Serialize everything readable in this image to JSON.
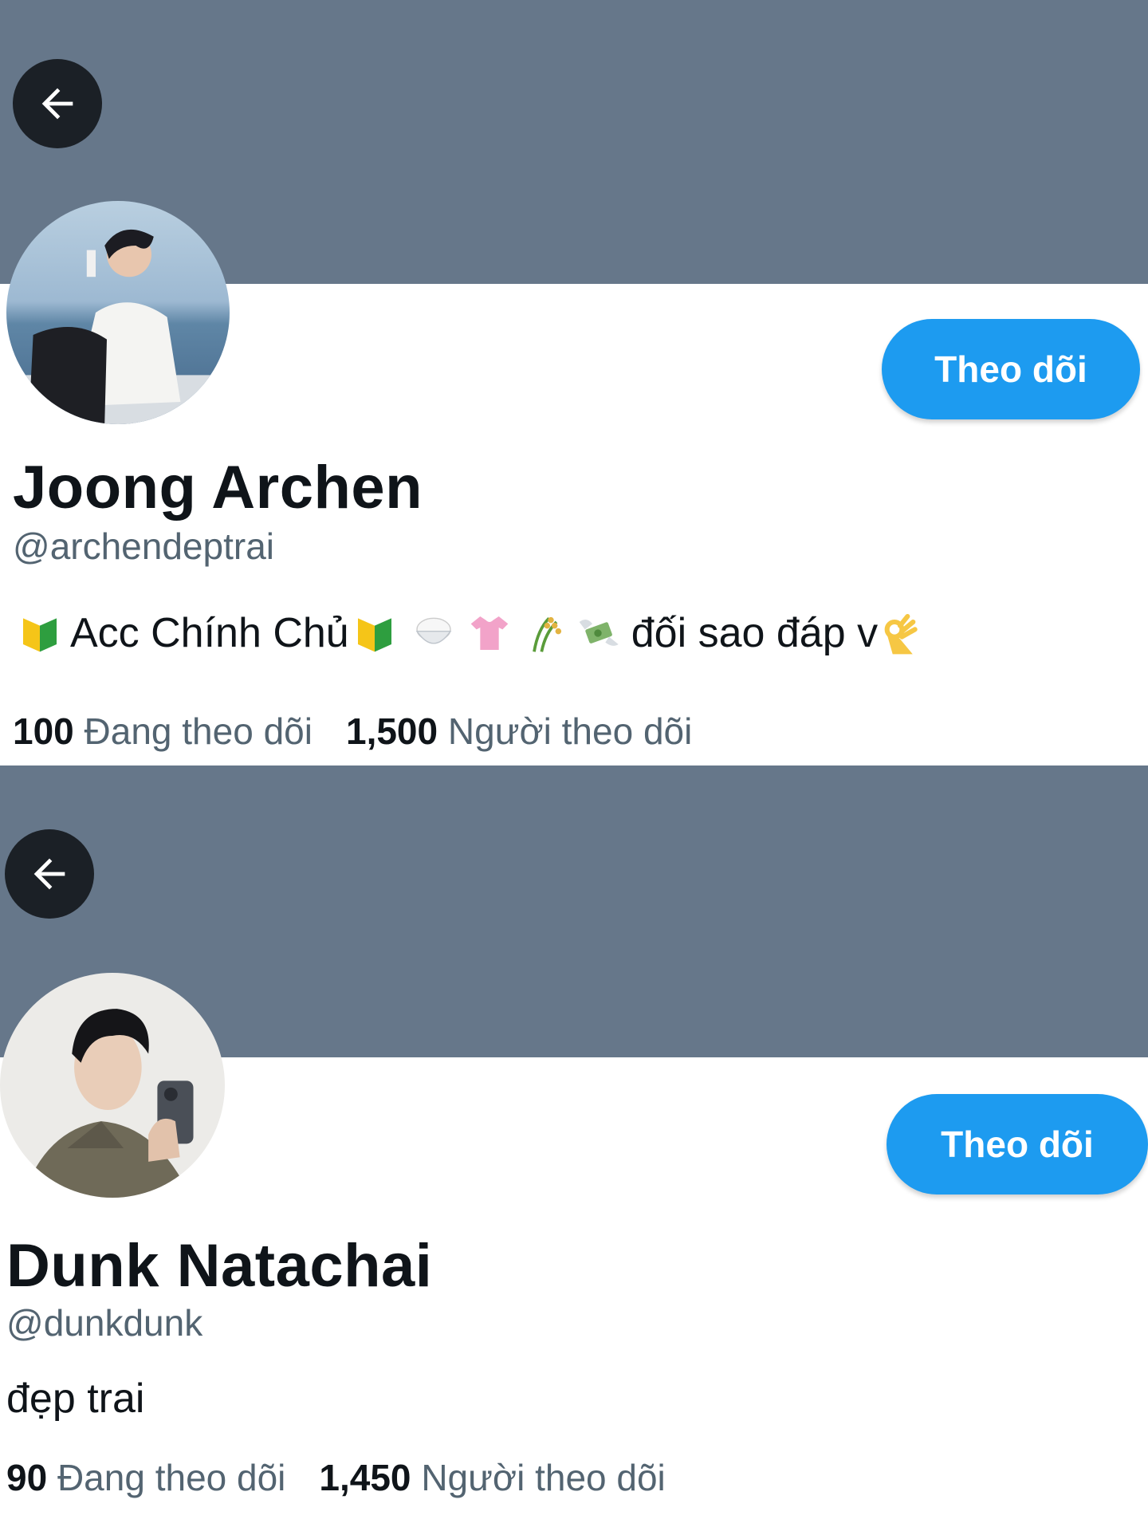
{
  "colors": {
    "banner": "#66778a",
    "accent": "#1d9bf0",
    "back_button": "#1b2026"
  },
  "profiles": [
    {
      "name": "Joong Archen",
      "handle": "@archendeptrai",
      "bio_text_1": "Acc Chính Chủ",
      "bio_text_2": "đối sao đáp v",
      "bio_icons": [
        "japanese-beginner-icon",
        "japanese-beginner-icon",
        "rice-bowl-icon",
        "blouse-icon",
        "rice-sheaf-icon",
        "money-wings-icon",
        "ok-hand-icon"
      ],
      "follow_label": "Theo dõi",
      "following_count": "100",
      "following_label": "Đang theo dõi",
      "followers_count": "1,500",
      "followers_label": "Người theo dõi"
    },
    {
      "name": "Dunk Natachai",
      "handle": "@dunkdunk",
      "bio": "đẹp trai",
      "follow_label": "Theo dõi",
      "following_count": "90",
      "following_label": "Đang theo dõi",
      "followers_count": "1,450",
      "followers_label": "Người theo dõi"
    }
  ]
}
